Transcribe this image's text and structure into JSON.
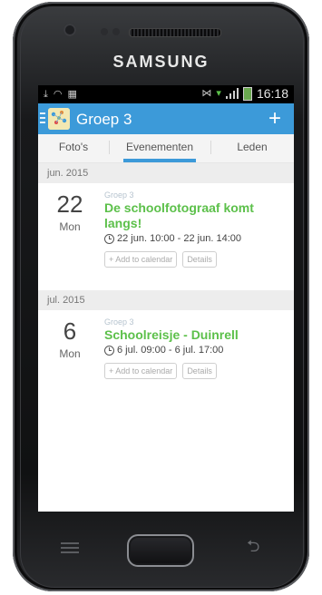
{
  "device": {
    "brand": "SAMSUNG"
  },
  "statusbar": {
    "time": "16:18"
  },
  "appbar": {
    "title": "Groep 3",
    "add_label": "+"
  },
  "tabs": [
    {
      "label": "Foto's"
    },
    {
      "label": "Evenementen"
    },
    {
      "label": "Leden"
    }
  ],
  "sections": [
    {
      "month": "jun. 2015",
      "event": {
        "day": "22",
        "dow": "Mon",
        "group": "Groep 3",
        "title": "De schoolfotograaf komt langs!",
        "time": "22 jun. 10:00 - 22 jun. 14:00",
        "add_to_calendar": "+ Add to calendar",
        "details": "Details"
      }
    },
    {
      "month": "jul. 2015",
      "event": {
        "day": "6",
        "dow": "Mon",
        "group": "Groep 3",
        "title": "Schoolreisje - Duinrell",
        "time": "6 jul. 09:00 - 6 jul. 17:00",
        "add_to_calendar": "+ Add to calendar",
        "details": "Details"
      }
    }
  ],
  "colors": {
    "accent": "#3c9ad9",
    "event_title": "#5cc04a"
  }
}
